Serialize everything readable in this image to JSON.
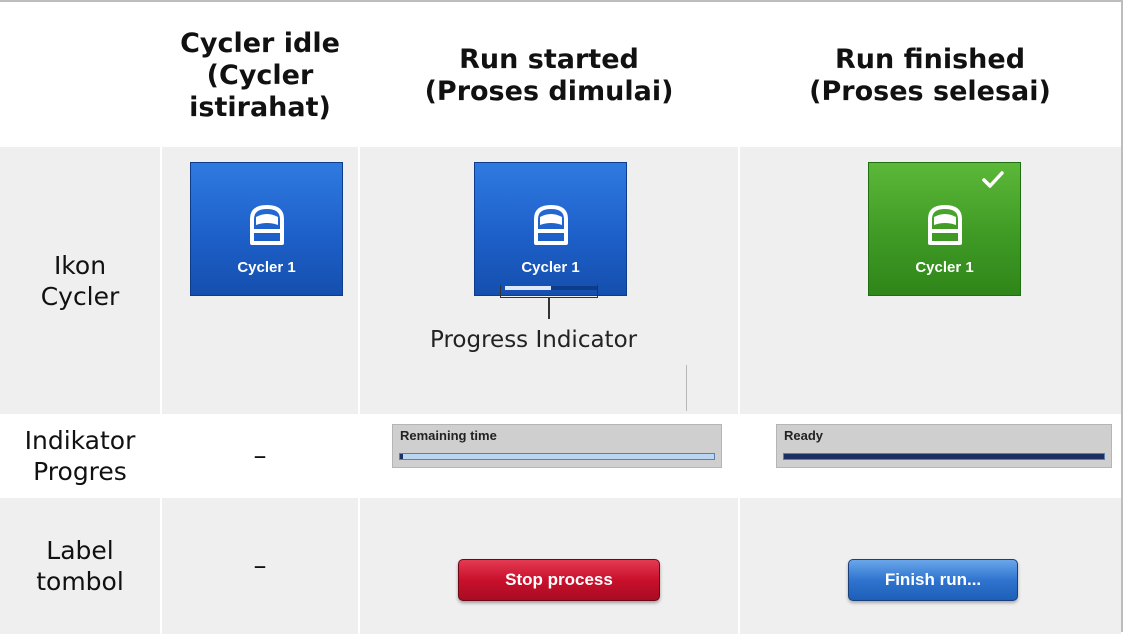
{
  "headers": {
    "col1": "Cycler idle (Cycler istirahat)",
    "col2": "Run started (Proses dimulai)",
    "col3": "Run finished (Proses selesai)"
  },
  "rows": {
    "icon_label": "Ikon Cycler",
    "progress_label": "Indikator Progres",
    "button_label": "Label tombol"
  },
  "cycler": {
    "name": "Cycler 1",
    "idle_icon": "cycler-icon",
    "finished_icon": "checkmark-icon",
    "running_progress_fraction": 0.5,
    "colors": {
      "idle": "#1d60c9",
      "running": "#1d60c9",
      "finished": "#3f9a25"
    }
  },
  "callout": {
    "text": "Progress Indicator"
  },
  "progress": {
    "idle_value": "–",
    "started": {
      "label": "Remaining time",
      "fraction": 0.0
    },
    "finished": {
      "label": "Ready",
      "fraction": 1.0
    }
  },
  "buttons": {
    "idle_value": "–",
    "started": {
      "label": "Stop process",
      "color": "#c9102c"
    },
    "finished": {
      "label": "Finish run...",
      "color": "#2f74cf"
    }
  }
}
